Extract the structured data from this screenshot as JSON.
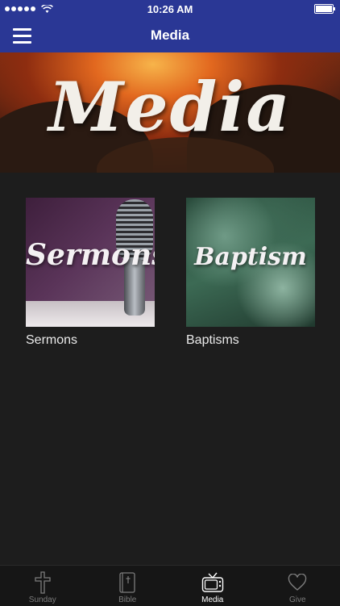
{
  "status": {
    "time": "10:26 AM"
  },
  "header": {
    "title": "Media"
  },
  "hero": {
    "title": "Media"
  },
  "tiles": [
    {
      "thumb_text": "Sermons",
      "label": "Sermons"
    },
    {
      "thumb_text": "Baptism",
      "label": "Baptisms"
    }
  ],
  "tabs": [
    {
      "label": "Sunday",
      "icon": "cross-icon",
      "active": false
    },
    {
      "label": "Bible",
      "icon": "bible-icon",
      "active": false
    },
    {
      "label": "Media",
      "icon": "tv-icon",
      "active": true
    },
    {
      "label": "Give",
      "icon": "heart-icon",
      "active": false
    }
  ],
  "colors": {
    "header": "#2a3795",
    "background": "#1d1d1d",
    "tabbar": "#161616"
  }
}
